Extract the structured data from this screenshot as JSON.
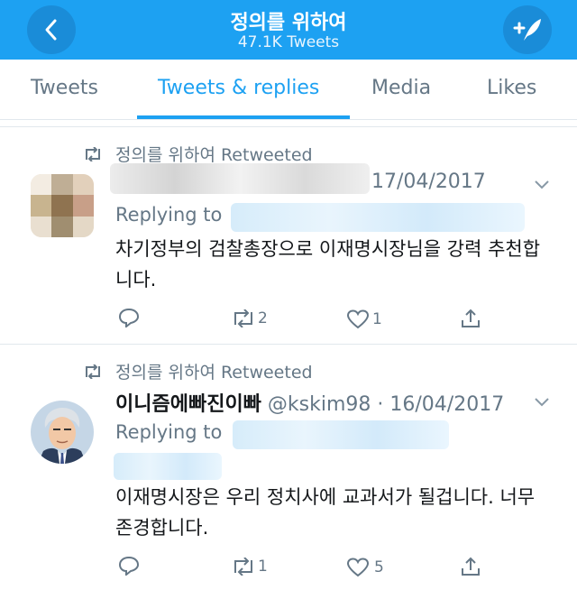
{
  "header": {
    "title": "정의를 위하여",
    "subtitle": "47.1K Tweets"
  },
  "tabs": [
    "Tweets",
    "Tweets & replies",
    "Media",
    "Likes"
  ],
  "active_tab": "Tweets & replies",
  "colors": {
    "brand": "#1da1f2",
    "secondary_text": "#657786",
    "text": "#14171a"
  },
  "tweets": [
    {
      "retweeted_by": "정의를 위하여 Retweeted",
      "name": "",
      "handle": "",
      "date": "17/04/2017",
      "replying_to": "Replying to",
      "text": "차기정부의 검찰총장으로 이재명시장님을 강력 추천합니다.",
      "replies": "",
      "retweets": "2",
      "likes": "1"
    },
    {
      "retweeted_by": "정의를 위하여 Retweeted",
      "name": "이니즘에빠진이빠",
      "handle": "@kskim98",
      "date": "16/04/2017",
      "replying_to": "Replying to",
      "text": "이재명시장은 우리 정치사에 교과서가 될겁니다. 너무 존경합니다.",
      "replies": "",
      "retweets": "1",
      "likes": "5"
    }
  ]
}
